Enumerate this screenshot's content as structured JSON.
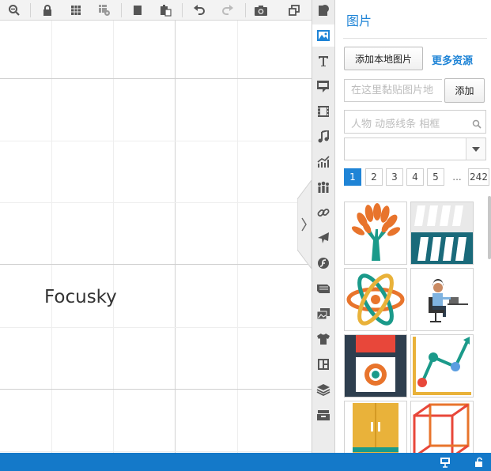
{
  "canvas": {
    "text": "Focusky"
  },
  "toolbar": {
    "icons": [
      "zoom-out-icon",
      "lock-icon",
      "grid-icon",
      "grid-settings-icon",
      "copy-icon",
      "paste-icon",
      "undo-icon",
      "redo-icon",
      "camera-icon",
      "resize-icon"
    ]
  },
  "sidebar_strip": {
    "icons": [
      "shape-icon",
      "image-icon",
      "text-icon",
      "note-icon",
      "video-icon",
      "music-icon",
      "chart-icon",
      "people-icon",
      "link-icon",
      "plane-icon",
      "flash-icon",
      "book-icon",
      "gallery-icon",
      "shirt-icon",
      "layout-icon",
      "layers-icon",
      "archive-icon"
    ],
    "active_index": 1
  },
  "panel": {
    "title": "图片",
    "add_local_label": "添加本地图片",
    "more_resources_label": "更多资源",
    "paste_placeholder": "在这里黏贴图片地",
    "add_label": "添加",
    "search_placeholder": "人物 动感线条 相框",
    "select_value": ""
  },
  "pagination": {
    "pages": [
      "1",
      "2",
      "3",
      "4",
      "5"
    ],
    "ellipsis": "...",
    "last": "242",
    "current": "1"
  },
  "thumbnails": [
    "tree-icon",
    "bars-icon",
    "atom-icon",
    "office-worker-icon",
    "disk-icon",
    "line-chart-icon",
    "cabinet-icon",
    "cube-icon"
  ],
  "colors": {
    "accent": "#1f84d6",
    "status_bar": "#1479c9",
    "orange": "#e8742c",
    "teal": "#1b9a8a",
    "dark": "#2e3e4e"
  }
}
